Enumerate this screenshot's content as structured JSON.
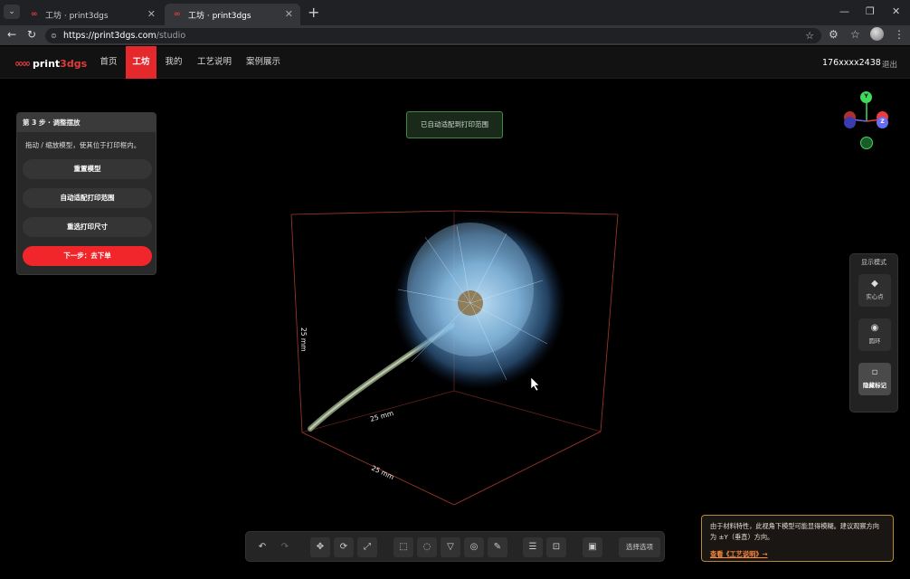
{
  "browser": {
    "tabs": [
      {
        "title": "工坊 · print3dgs",
        "active": false
      },
      {
        "title": "工坊 · print3dgs",
        "active": true
      }
    ],
    "url_host": "https://print3dgs.com",
    "url_path": "/studio"
  },
  "app": {
    "logo": {
      "text_a": "print",
      "text_b": "3dgs"
    },
    "nav": [
      "首页",
      "工坊",
      "我的",
      "工艺说明",
      "案例展示"
    ],
    "active_nav": "工坊",
    "user": "176xxxx2438",
    "logout": "退出"
  },
  "step_panel": {
    "title": "第 3 步 · 调整摆放",
    "description": "拖动 / 缩放模型，使其位于打印框内。",
    "buttons": [
      "重置模型",
      "自动适配打印范围",
      "重选打印尺寸"
    ],
    "next_button": "下一步：去下单"
  },
  "toast": "已自动适配到打印范围",
  "dimension_labels": {
    "height": "25 mm",
    "depth": "25 mm",
    "width": "25 mm"
  },
  "axis_gizmo": {
    "y": "Y",
    "z": "Z",
    "y_color": "#3ddc5a",
    "z_color": "#6a6cf0",
    "x_color": "#f03a3a"
  },
  "display_mode": {
    "title": "显示模式",
    "buttons": [
      {
        "icon": "diamond-icon",
        "label": "实心点",
        "active": false
      },
      {
        "icon": "ring-icon",
        "label": "圆环",
        "active": false
      },
      {
        "icon": "hidden-marker-icon",
        "label": "隐藏标记",
        "active": true
      }
    ]
  },
  "toolbar": {
    "select_options_label": "选择选项"
  },
  "notice": {
    "text": "由于材料特性，此视角下模型可能显得模糊。建议观察方向为 ±Y（垂直）方向。",
    "link": "查看《工艺说明》→"
  },
  "colors": {
    "accent": "#e5282c",
    "notice_border": "#b8892e",
    "toast_border": "#3f8a3f"
  }
}
